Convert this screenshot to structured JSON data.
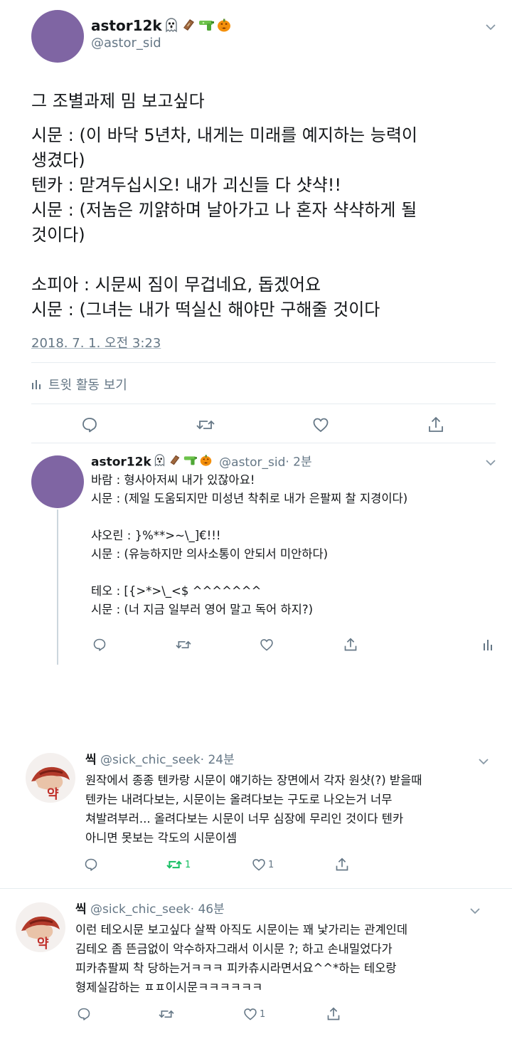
{
  "main": {
    "display_name": "astor12k",
    "handle": "@astor_sid",
    "emojis": [
      "ghost-emoji",
      "coffin-emoji",
      "water-pistol-emoji",
      "jack-o-lantern-emoji"
    ],
    "paragraphs": [
      "그 조별과제 밈 보고싶다",
      "시문 : (이 바닥 5년차, 내게는 미래를 예지하는 능력이\n생겼다)\n텐카 : 맏겨두십시오! 내가 괴신들 다 샷샥!!\n시문 : (저놈은 끼얅하며 날아가고 나 혼자 샥샥하게 될\n것이다)",
      "소피아 : 시문씨 짐이 무겁네요, 돕겠어요\n시문 : (그녀는 내가 떡실신 해야만 구해줄 것이다"
    ],
    "timestamp": "2018. 7. 1. 오전 3:23",
    "activity_label": "트윗 활동 보기"
  },
  "reply1": {
    "display_name": "astor12k",
    "handle": "@astor_sid",
    "time": "· 2분",
    "text": "바람 : 형사아저씨 내가 있잖아요!\n시문 : (제일 도움되지만 미성년 착취로 내가 은팔찌 찰 지경이다)\n\n샤오린 : }%**>~\\_]€!!!\n시문 : (유능하지만 의사소통이 안되서 미안하다)\n\n테오 : [{>*>\\_<$ ^^^^^^^\n시문 : (너 지금 일부러 영어 말고 독어 하지?)"
  },
  "reply2": {
    "display_name": "씩",
    "handle": "@sick_chic_seek",
    "time": "· 24분",
    "text": "원작에서 종종 텐카랑 시문이 얘기하는 장면에서 각자 원샷(?) 받을때\n텐카는 내려다보는, 시문이는 올려다보는 구도로 나오는거 너무\n쳐발려부러... 올려다보는 시문이 너무 심장에 무리인 것이다 텐카\n아니면 못보는 각도의 시문이셈",
    "retweet_count": "1",
    "like_count": "1"
  },
  "reply3": {
    "display_name": "씩",
    "handle": "@sick_chic_seek",
    "time": "· 46분",
    "text": "이런 테오시문 보고싶다 살짝 아직도 시문이는 꽤 낯가리는 관계인데\n김테오 좀 뜬금없이 악수하자그래서 이시문 ?; 하고 손내밀었다가\n피카츄팔찌 착 당하는거ㅋㅋㅋ 피카츄시라면서요^^*하는 테오랑\n형제실감하는 ㅍㅍ이시문ㅋㅋㅋㅋㅋㅋ",
    "like_count": "1"
  },
  "colors": {
    "avatar_purple": "#7f65a3",
    "retweet_green": "#17bf63",
    "icon_gray": "#657786"
  }
}
